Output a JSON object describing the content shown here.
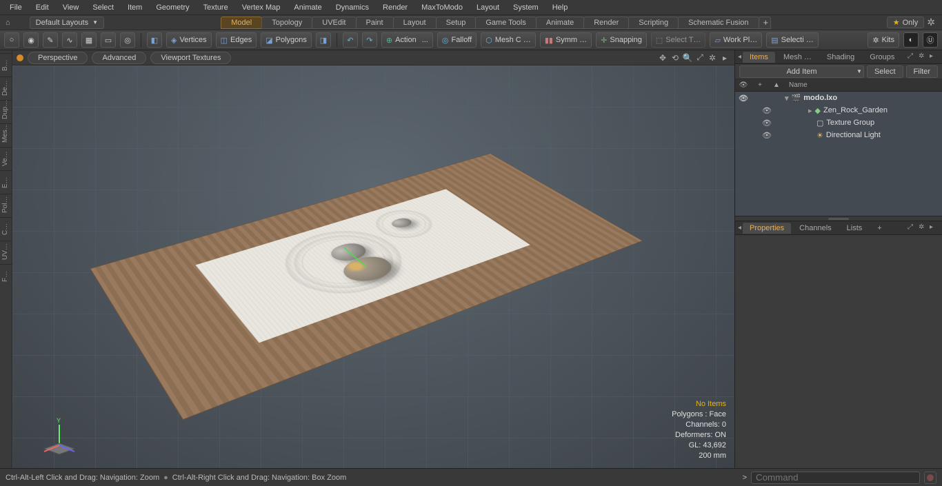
{
  "menu": [
    "File",
    "Edit",
    "View",
    "Select",
    "Item",
    "Geometry",
    "Texture",
    "Vertex Map",
    "Animate",
    "Dynamics",
    "Render",
    "MaxToModo",
    "Layout",
    "System",
    "Help"
  ],
  "layout": {
    "dropdown": "Default Layouts",
    "tabs": [
      "Model",
      "Topology",
      "UVEdit",
      "Paint",
      "Layout",
      "Setup",
      "Game Tools",
      "Animate",
      "Render",
      "Scripting",
      "Schematic Fusion"
    ],
    "active_tab": "Model",
    "only": "Only"
  },
  "toolbar": {
    "vertices": "Vertices",
    "edges": "Edges",
    "polygons": "Polygons",
    "action": "Action",
    "action_ell": "...",
    "falloff": "Falloff",
    "meshc": "Mesh C …",
    "symm": "Symm …",
    "snapping": "Snapping",
    "selt": "Select T…",
    "workpl": "Work Pl…",
    "selecti": "Selecti …",
    "kits": "Kits"
  },
  "leftstrip": [
    "B…",
    "De…",
    "Dup…",
    "Mes…",
    "Ve…",
    "E…",
    "Pol…",
    "C…",
    "UV…",
    "F…"
  ],
  "vpheader": {
    "perspective": "Perspective",
    "advanced": "Advanced",
    "vtex": "Viewport Textures"
  },
  "vpinfo": {
    "noitems": "No Items",
    "polys": "Polygons : Face",
    "channels": "Channels: 0",
    "deformers": "Deformers: ON",
    "gl": "GL: 43,692",
    "scale": "200 mm"
  },
  "rtabs_top": [
    "Items",
    "Mesh …",
    "Shading",
    "Groups"
  ],
  "rtabs_top_active": "Items",
  "additem": "Add Item",
  "select": "Select",
  "filter": "Filter",
  "tree_name": "Name",
  "tree": [
    {
      "label": "modo.lxo",
      "type": "scene",
      "depth": 0,
      "bold": true,
      "open": true
    },
    {
      "label": "Zen_Rock_Garden",
      "type": "mesh",
      "depth": 1
    },
    {
      "label": "Texture Group",
      "type": "group",
      "depth": 1
    },
    {
      "label": "Directional Light",
      "type": "light",
      "depth": 1
    }
  ],
  "rtabs_bot": [
    "Properties",
    "Channels",
    "Lists"
  ],
  "rtabs_bot_active": "Properties",
  "status": {
    "left1": "Ctrl-Alt-Left Click and Drag: Navigation: Zoom",
    "left2": "Ctrl-Alt-Right Click and Drag: Navigation: Box Zoom",
    "prompt": ">",
    "cmd_placeholder": "Command"
  }
}
